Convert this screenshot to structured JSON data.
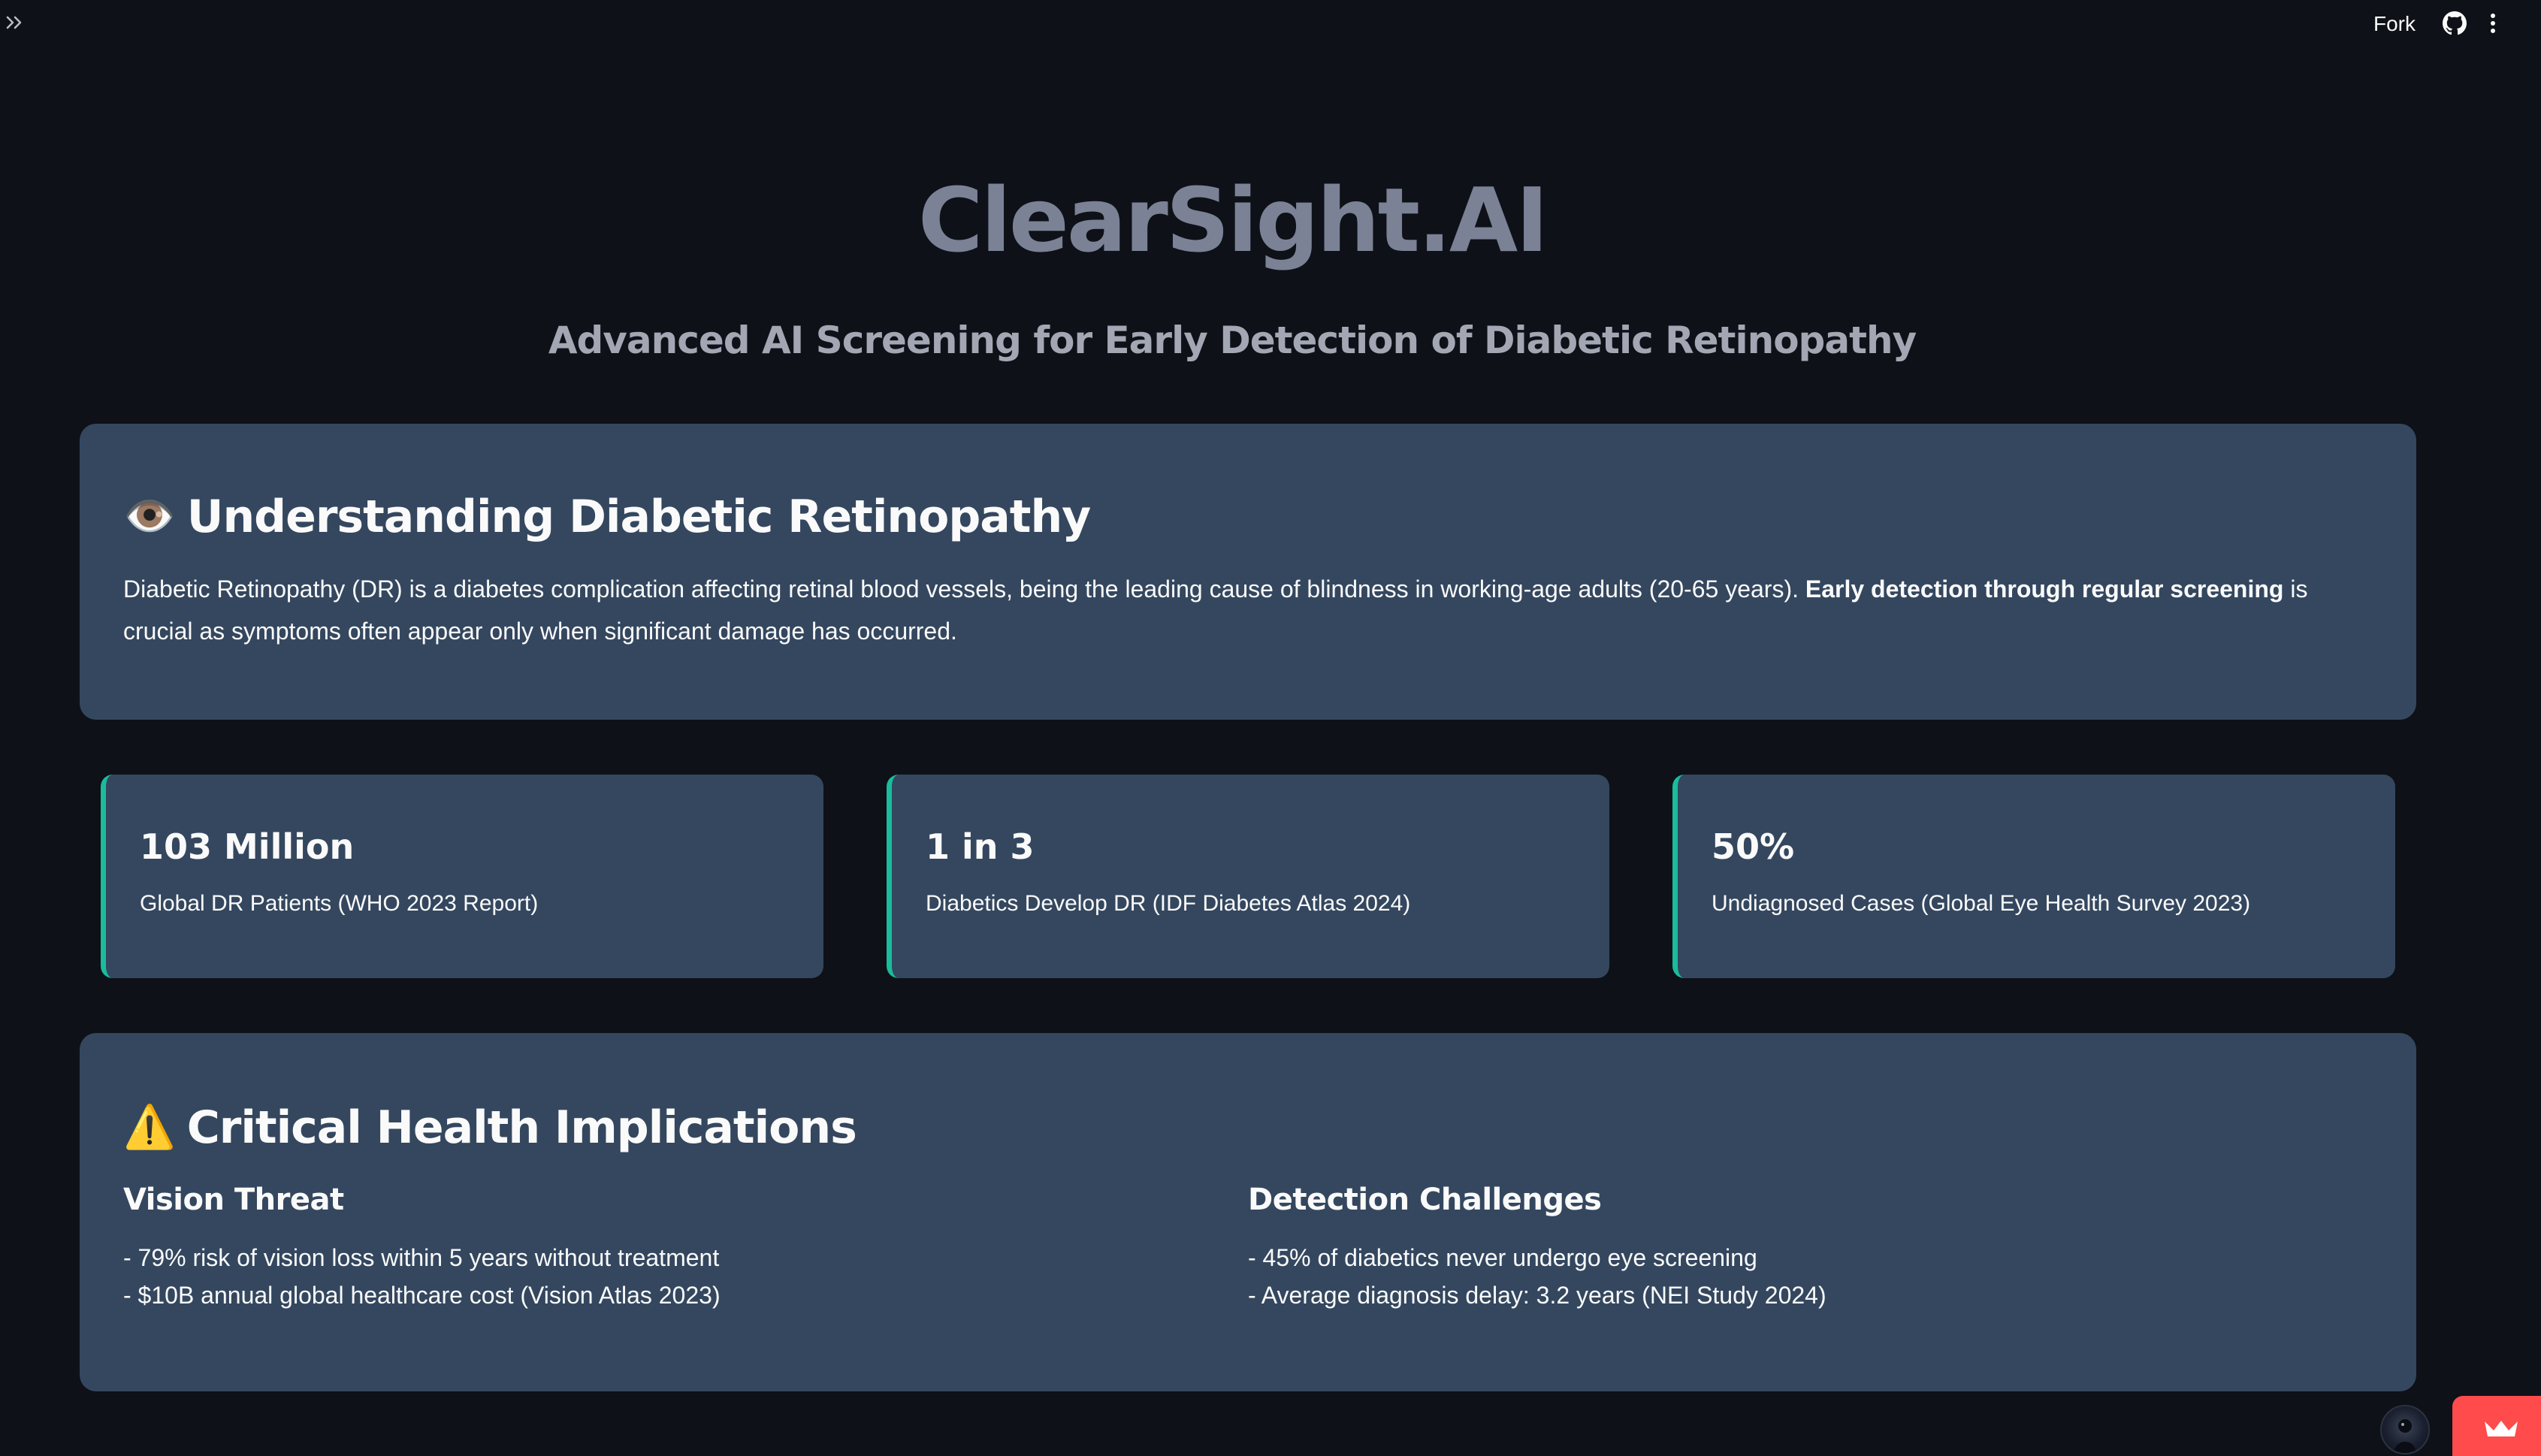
{
  "toolbar": {
    "fork_label": "Fork"
  },
  "hero": {
    "title": "ClearSight.AI",
    "subtitle": "Advanced AI Screening for Early Detection of Diabetic Retinopathy"
  },
  "understanding": {
    "emoji": "👁️",
    "heading": "Understanding Diabetic Retinopathy",
    "body_before": "Diabetic Retinopathy (DR) is a diabetes complication affecting retinal blood vessels, being the leading cause of blindness in working-age adults (20-65 years). ",
    "body_bold": "Early detection through regular screening",
    "body_after": " is crucial as symptoms often appear only when significant damage has occurred."
  },
  "stats": [
    {
      "value": "103 Million",
      "label": "Global DR Patients (WHO 2023 Report)"
    },
    {
      "value": "1 in 3",
      "label": "Diabetics Develop DR (IDF Diabetes Atlas 2024)"
    },
    {
      "value": "50%",
      "label": "Undiagnosed Cases (Global Eye Health Survey 2023)"
    }
  ],
  "critical": {
    "emoji": "⚠️",
    "heading": "Critical Health Implications",
    "columns": [
      {
        "title": "Vision Threat",
        "lines": [
          "- 79% risk of vision loss within 5 years without treatment",
          "- $10B annual global healthcare cost (Vision Atlas 2023)"
        ]
      },
      {
        "title": "Detection Challenges",
        "lines": [
          "- 45% of diabetics never undergo eye screening",
          "- Average diagnosis delay: 3.2 years (NEI Study 2024)"
        ]
      }
    ]
  },
  "colors": {
    "background": "#0e1117",
    "card": "#34475f",
    "accent": "#1abc9c",
    "badge": "#ff4b4b"
  },
  "icons": {
    "expand": "double-chevron-right-icon",
    "github": "github-icon",
    "menu": "vertical-dots-icon",
    "badge": "crown-icon"
  }
}
